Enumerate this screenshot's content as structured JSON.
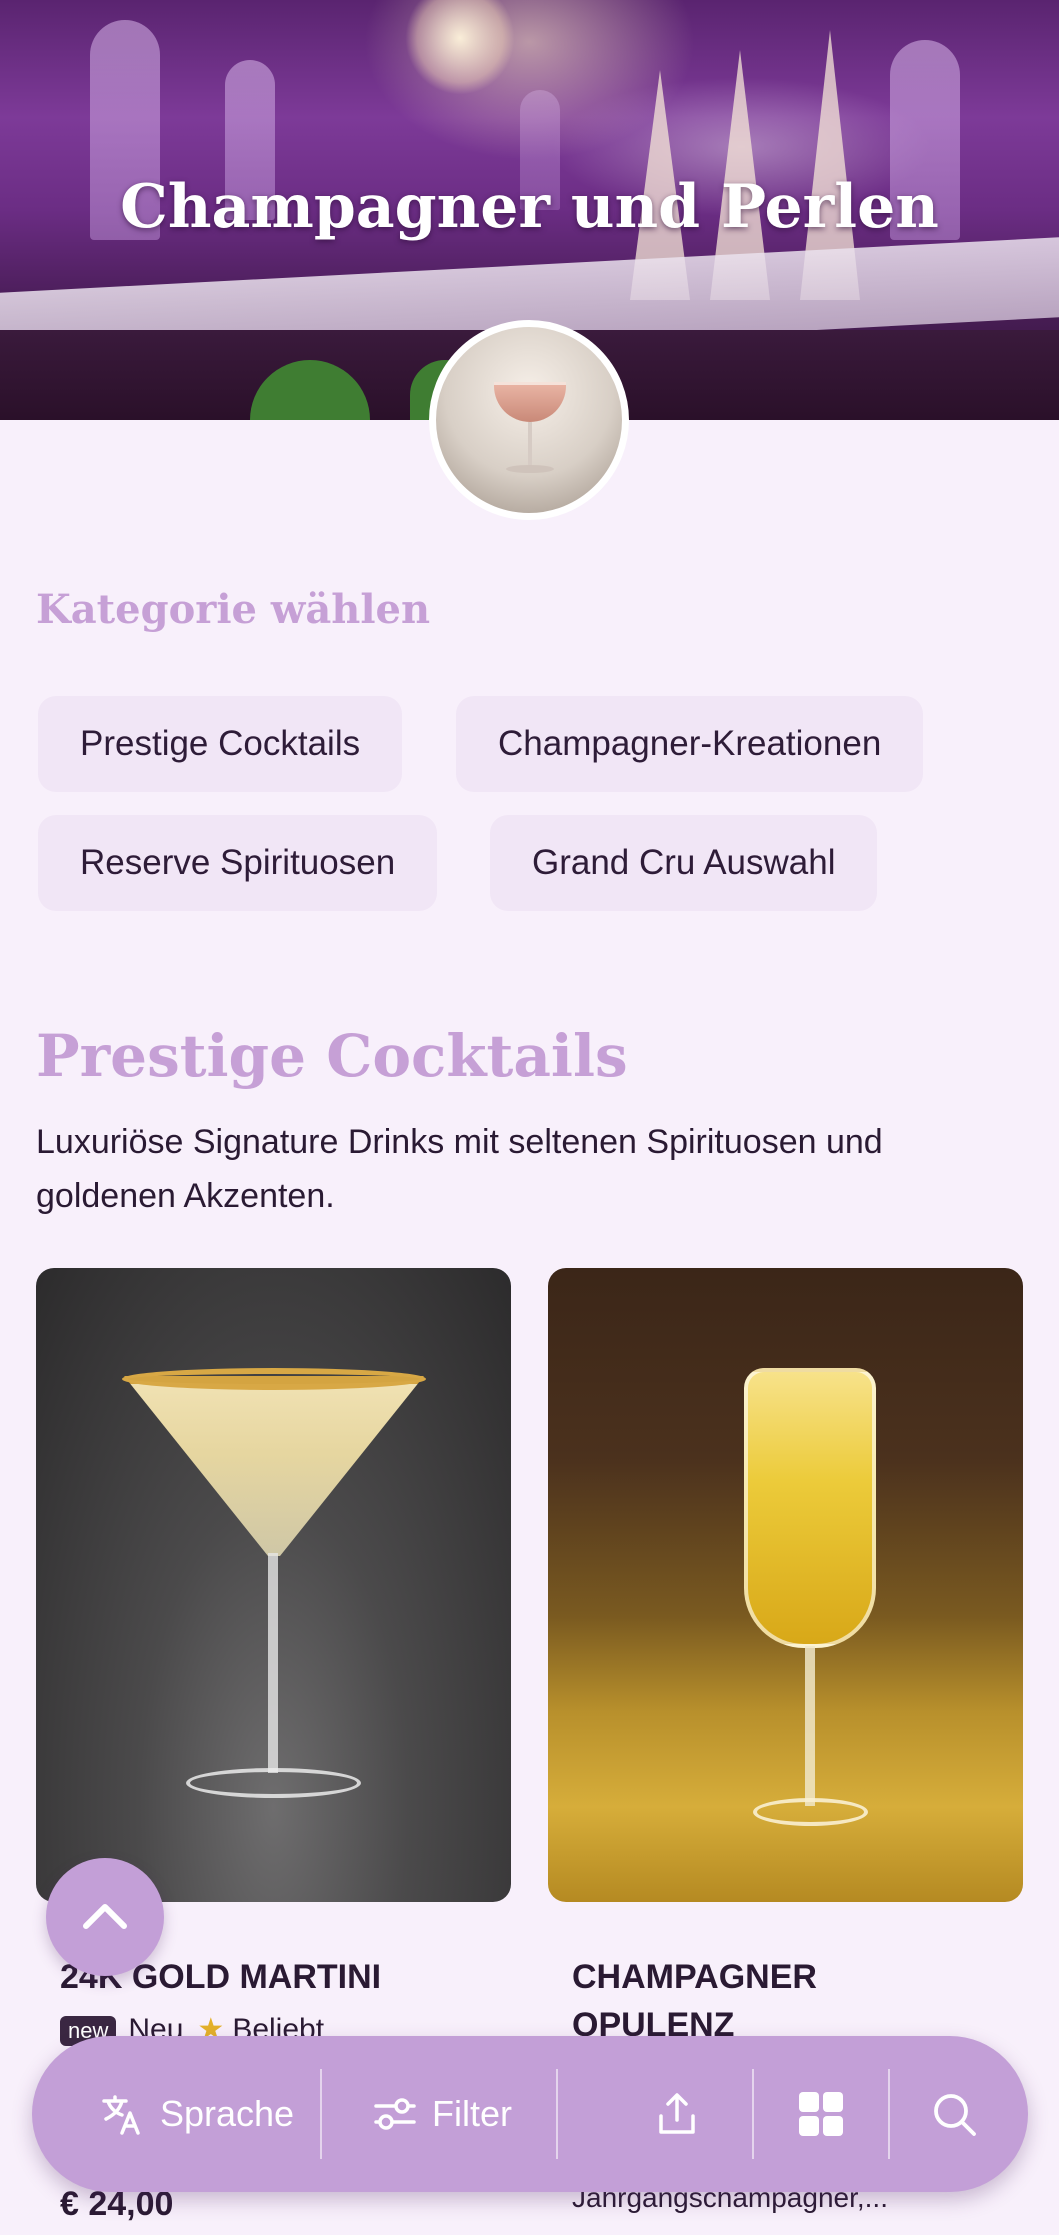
{
  "hero": {
    "title": "Champagner und Perlen"
  },
  "categories": {
    "heading": "Kategorie wählen",
    "chips": [
      {
        "label": "Prestige Cocktails"
      },
      {
        "label": "Champagner-Kreationen"
      },
      {
        "label": "Reserve Spirituosen"
      },
      {
        "label": "Grand Cru Auswahl"
      }
    ]
  },
  "section": {
    "title": "Prestige Cocktails",
    "description": "Luxuriöse Signature Drinks mit seltenen Spirituosen und goldenen Akzenten."
  },
  "products": [
    {
      "name": "24K GOLD MARTINI",
      "badge": "new",
      "badge_text": "Neu",
      "popular": "Beliebt",
      "price": "€ 24,00"
    },
    {
      "name": "CHAMPAGNER OPULENZ",
      "description": "Jahrgangschampagner,..."
    }
  ],
  "bottom_bar": {
    "language_label": "Sprache",
    "filter_label": "Filter"
  },
  "colors": {
    "accent": "#c39fd7",
    "heading": "#c6a0d6",
    "background": "#f8f0fb",
    "chip": "#f1e6f6"
  },
  "icons": [
    "translate-icon",
    "filter-icon",
    "share-icon",
    "grid-icon",
    "search-icon",
    "chevron-up-icon",
    "star-icon"
  ]
}
